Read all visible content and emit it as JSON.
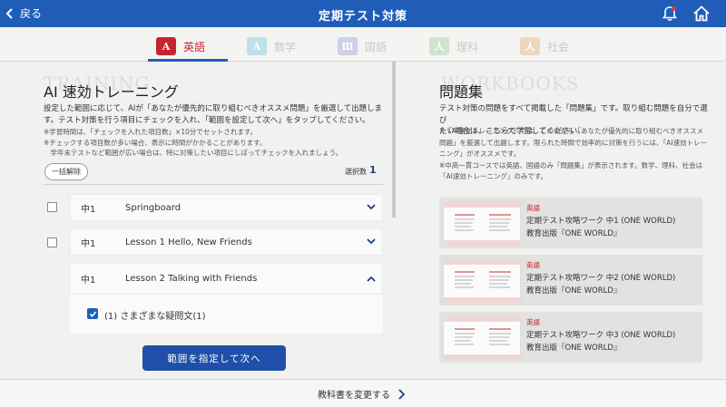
{
  "header": {
    "back_label": "戻る",
    "title": "定期テスト対策"
  },
  "tabs": [
    {
      "label": "英語",
      "icon_text": "A",
      "icon_color": "#c8232e",
      "active": true
    },
    {
      "label": "数学",
      "icon_text": "A",
      "icon_color": "#bfe0ea",
      "active": false
    },
    {
      "label": "国語",
      "icon_text": "Ⅲ",
      "icon_color": "#cdd0e6",
      "active": false
    },
    {
      "label": "理科",
      "icon_text": "人",
      "icon_color": "#cfe4cf",
      "active": false
    },
    {
      "label": "社会",
      "icon_text": "人",
      "icon_color": "#eed7bd",
      "active": false
    }
  ],
  "left": {
    "watermark": "TRAINING",
    "title": "AI 速効トレーニング",
    "desc_line1": "設定した範囲に応じて、AIが「あなたが優先的に取り組むべきオススメ問題」を厳選して出題しま",
    "desc_line2": "す。テスト対策を行う項目にチェックを入れ、「範囲を設定して次へ」をタップしてください。",
    "note_line1": "※学習時間は、「チェックを入れた項目数」×10分でセットされます。",
    "note_line2": "※チェックする項目数が多い場合、表示に時間がかかることがあります。",
    "note_line3": "　学年末テストなど範囲が広い場合は、特に対策したい項目にしぼってチェックを入れましょう。",
    "clear_label": "一括解除",
    "count_label": "選択数",
    "count_value": "1",
    "rows": [
      {
        "grade": "中1",
        "lesson": "Springboard",
        "checked": false,
        "expanded": false
      },
      {
        "grade": "中1",
        "lesson": "Lesson 1 Hello, New Friends",
        "checked": false,
        "expanded": false
      },
      {
        "grade": "中1",
        "lesson": "Lesson 2 Talking with Friends",
        "checked": false,
        "expanded": true
      }
    ],
    "sub_item": {
      "label": "(1) さまざまな疑問文(1)",
      "checked": true
    },
    "submit_label": "範囲を指定して次へ"
  },
  "right": {
    "watermark": "WORKBOOKS",
    "title": "問題集",
    "desc_line1": "テスト対策の問題をすべて掲載した「問題集」です。取り組む問題を自分で選び",
    "desc_line2": "たい場合は、こちらで学習してください。",
    "note_line1": "※「AI速効トレーニング」では、この中から「あなたが優先的に取り組むべきオススメ",
    "note_line2": "問題」を厳選して出題します。限られた時間で効率的に対策を行うには、「AI速効トレー",
    "note_line3": "ニング」がオススメです。",
    "note_line4": "※中高一貫コースでは英語、国語のみ「問題集」が表示されます。数学、理科、社会は",
    "note_line5": "「AI速効トレーニング」のみです。",
    "cards": [
      {
        "subject": "英語",
        "name": "定期テスト攻略ワーク 中1 (ONE WORLD)",
        "publisher": "教育出版『ONE WORLD』"
      },
      {
        "subject": "英語",
        "name": "定期テスト攻略ワーク 中2 (ONE WORLD)",
        "publisher": "教育出版『ONE WORLD』"
      },
      {
        "subject": "英語",
        "name": "定期テスト攻略ワーク 中3 (ONE WORLD)",
        "publisher": "教育出版『ONE WORLD』"
      }
    ]
  },
  "footer": {
    "change_label": "教科書を変更する"
  },
  "colors": {
    "header_blue": "#1f5db8",
    "button_blue": "#1f4fa8",
    "english_red": "#c8232e"
  }
}
